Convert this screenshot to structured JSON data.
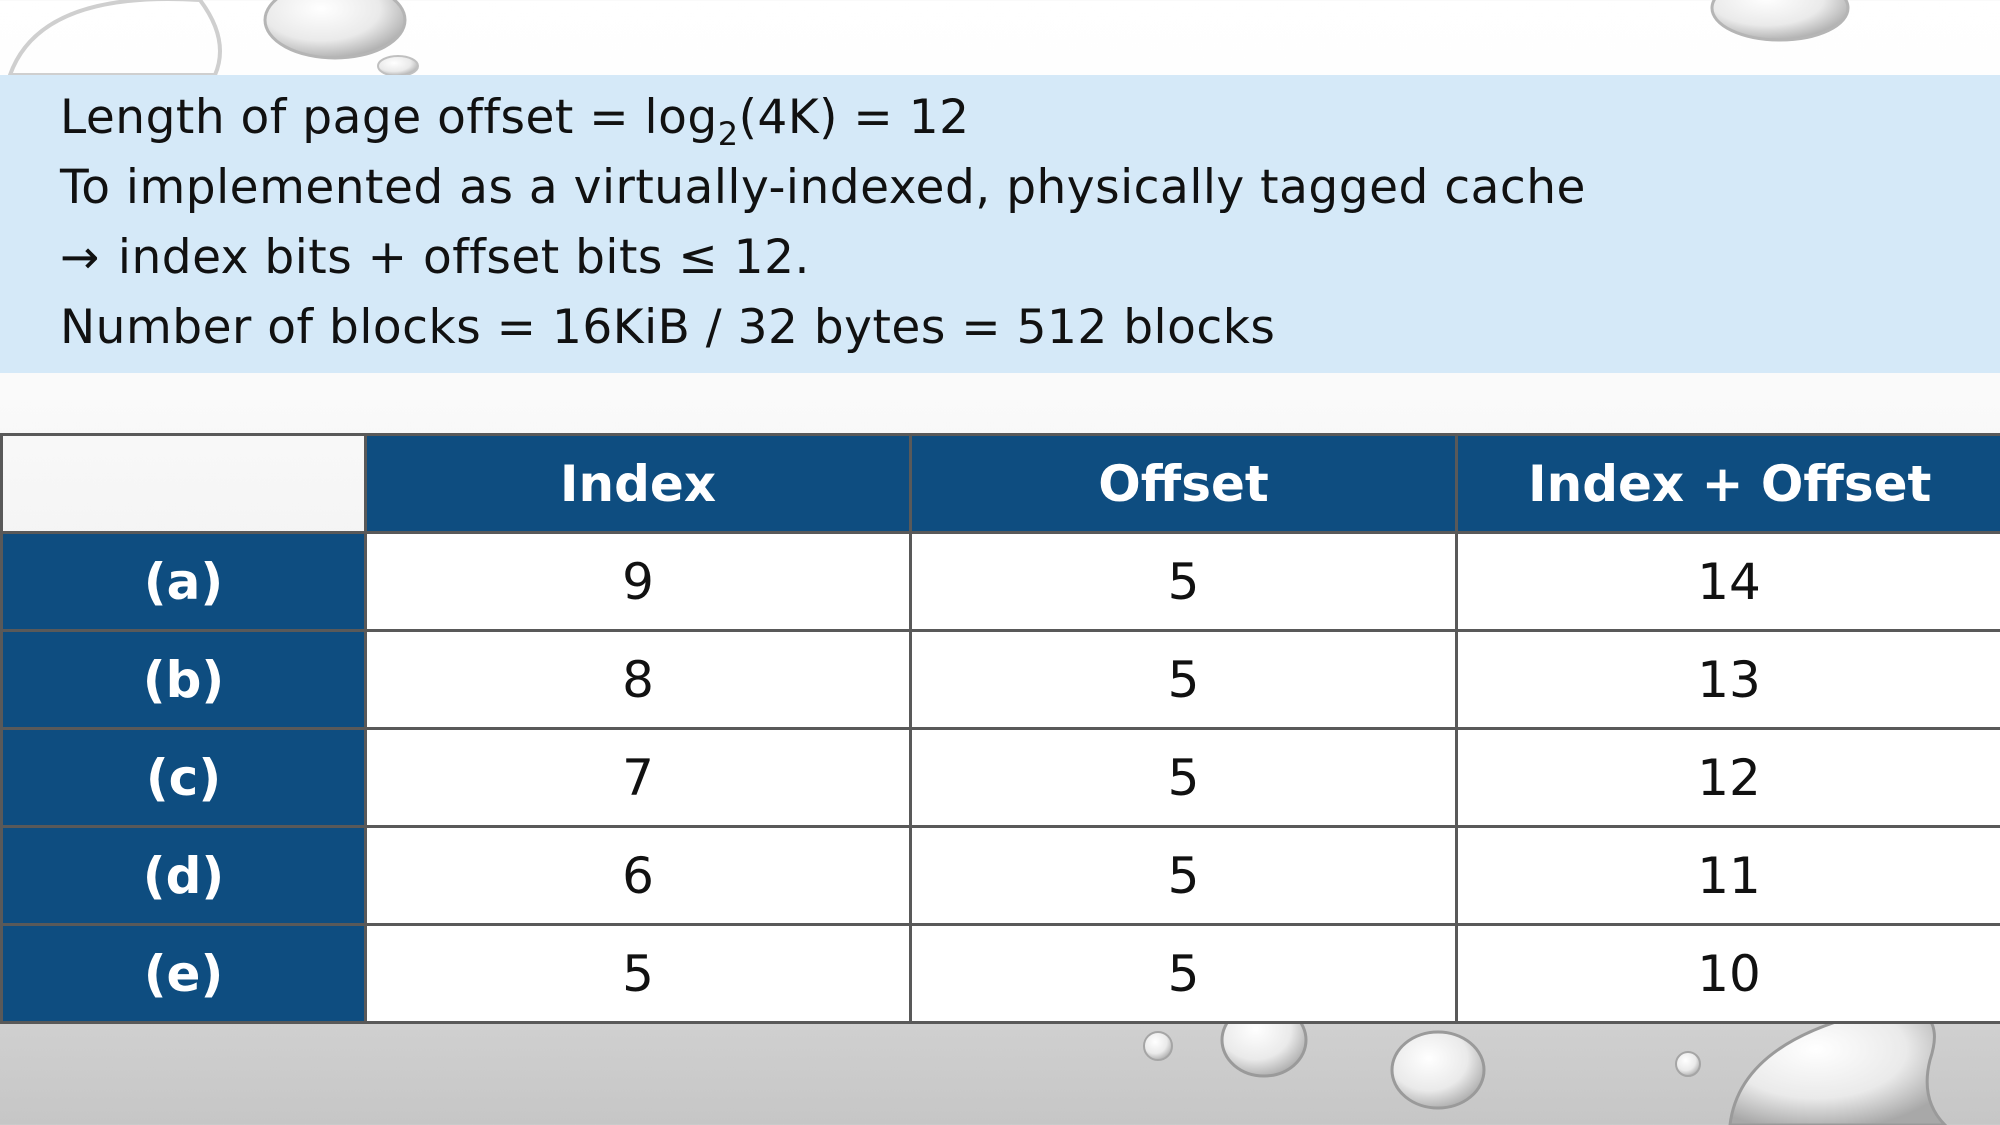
{
  "text_block": {
    "line1_pre": "Length of page offset = log",
    "line1_sub": "2",
    "line1_post": "(4K) = 12",
    "line2": "To implemented as a virtually-indexed, physically tagged cache",
    "line3_arrow": "→",
    "line3_text": "index bits + offset bits ≤ 12.",
    "line4": "Number of blocks = 16KiB / 32 bytes = 512 blocks"
  },
  "table": {
    "headers": [
      "Index",
      "Offset",
      "Index + Offset"
    ],
    "rows": [
      {
        "label": "(a)",
        "values": [
          "9",
          "5",
          "14"
        ]
      },
      {
        "label": "(b)",
        "values": [
          "8",
          "5",
          "13"
        ]
      },
      {
        "label": "(c)",
        "values": [
          "7",
          "5",
          "12"
        ]
      },
      {
        "label": "(d)",
        "values": [
          "6",
          "5",
          "11"
        ]
      },
      {
        "label": "(e)",
        "values": [
          "5",
          "5",
          "10"
        ]
      }
    ]
  },
  "colors": {
    "header_blue": "#0e4d80",
    "band_blue": "#d5e9f8"
  }
}
